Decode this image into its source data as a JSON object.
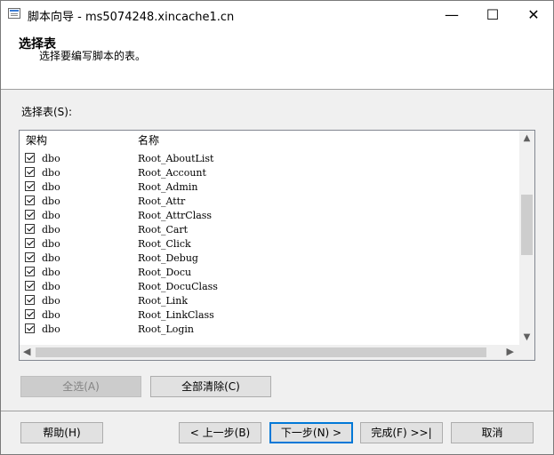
{
  "window": {
    "title": "脚本向导 - ms5074248.xincache1.cn",
    "minimize": "—",
    "maximize": "☐",
    "close": "✕"
  },
  "header": {
    "title": "选择表",
    "subtitle": "选择要编写脚本的表。"
  },
  "section_label": "选择表(S):",
  "columns": {
    "schema": "架构",
    "name": "名称"
  },
  "rows": [
    {
      "schema": "dbo",
      "name": "Root_AboutList"
    },
    {
      "schema": "dbo",
      "name": "Root_Account"
    },
    {
      "schema": "dbo",
      "name": "Root_Admin"
    },
    {
      "schema": "dbo",
      "name": "Root_Attr"
    },
    {
      "schema": "dbo",
      "name": "Root_AttrClass"
    },
    {
      "schema": "dbo",
      "name": "Root_Cart"
    },
    {
      "schema": "dbo",
      "name": "Root_Click"
    },
    {
      "schema": "dbo",
      "name": "Root_Debug"
    },
    {
      "schema": "dbo",
      "name": "Root_Docu"
    },
    {
      "schema": "dbo",
      "name": "Root_DocuClass"
    },
    {
      "schema": "dbo",
      "name": "Root_Link"
    },
    {
      "schema": "dbo",
      "name": "Root_LinkClass"
    },
    {
      "schema": "dbo",
      "name": "Root_Login"
    }
  ],
  "buttons": {
    "select_all": "全选(A)",
    "clear_all": "全部清除(C)",
    "help": "帮助(H)",
    "prev": "< 上一步(B)",
    "next": "下一步(N) >",
    "finish": "完成(F) >>|",
    "cancel": "取消"
  }
}
